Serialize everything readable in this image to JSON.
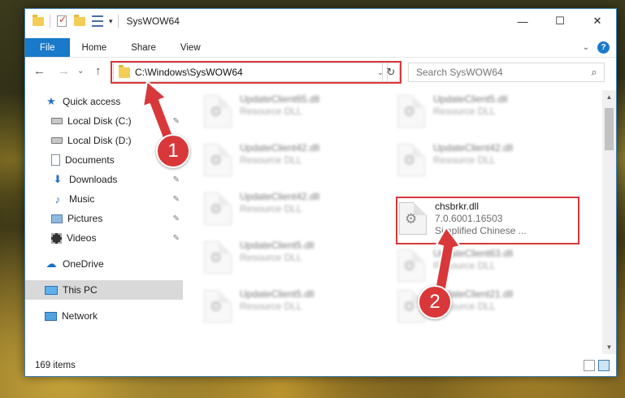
{
  "window": {
    "title": "SysWOW64"
  },
  "controls": {
    "minimize": "—",
    "maximize": "☐",
    "close": "✕"
  },
  "ribbon": {
    "tabs": [
      "File",
      "Home",
      "Share",
      "View"
    ],
    "collapse": "⌄",
    "help": "?"
  },
  "nav": {
    "back": "←",
    "forward": "→",
    "recent": "⌄",
    "up": "↑",
    "address": "C:\\Windows\\SysWOW64",
    "address_dropdown": "⌄",
    "refresh": "↻",
    "search_placeholder": "Search SysWOW64",
    "search_icon": "⌕"
  },
  "sidebar": {
    "items": [
      {
        "label": "Quick access",
        "icon": "star-icon"
      },
      {
        "label": "Local Disk (C:)",
        "icon": "disk-icon",
        "pinned": true
      },
      {
        "label": "Local Disk (D:)",
        "icon": "disk-icon"
      },
      {
        "label": "Documents",
        "icon": "document-icon"
      },
      {
        "label": "Downloads",
        "icon": "download-icon",
        "pinned": true
      },
      {
        "label": "Music",
        "icon": "music-icon",
        "pinned": true
      },
      {
        "label": "Pictures",
        "icon": "pictures-icon",
        "pinned": true
      },
      {
        "label": "Videos",
        "icon": "videos-icon",
        "pinned": true
      },
      {
        "label": "OneDrive",
        "icon": "onedrive-icon"
      },
      {
        "label": "This PC",
        "icon": "pc-icon",
        "selected": true
      },
      {
        "label": "Network",
        "icon": "network-icon"
      }
    ],
    "pin_glyph": "📌"
  },
  "files": [
    {
      "name": "UpdateClient65.dll",
      "sub": "Resource DLL",
      "blurred": true
    },
    {
      "name": "UpdateClient5.dll",
      "sub": "Resource DLL",
      "blurred": true
    },
    {
      "name": "UpdateClient42.dll",
      "sub": "Resource DLL",
      "blurred": true
    },
    {
      "name": "UpdateClient42.dll",
      "sub": "Resource DLL",
      "blurred": true
    },
    {
      "name": "UpdateClient42.dll",
      "sub": "Resource DLL",
      "blurred": true
    },
    {
      "name": "chsbrkr.dll",
      "sub": "7.0.6001.16503",
      "sub2": "Simplified Chinese ...",
      "blurred": false
    },
    {
      "name": "UpdateClient5.dll",
      "sub": "Resource DLL",
      "blurred": true
    },
    {
      "name": "UpdateClient63.dll",
      "sub": "Resource DLL",
      "blurred": true
    },
    {
      "name": "UpdateClient5.dll",
      "sub": "Resource DLL",
      "blurred": true
    },
    {
      "name": "UpdateClient21.dll",
      "sub": "Resource DLL",
      "blurred": true
    }
  ],
  "status": {
    "items_count": "169 items"
  },
  "annotations": {
    "step1": "1",
    "step2": "2",
    "highlight_color": "#d9383a"
  },
  "colors": {
    "accent": "#1979ca",
    "selected": "#d9d9d9"
  }
}
